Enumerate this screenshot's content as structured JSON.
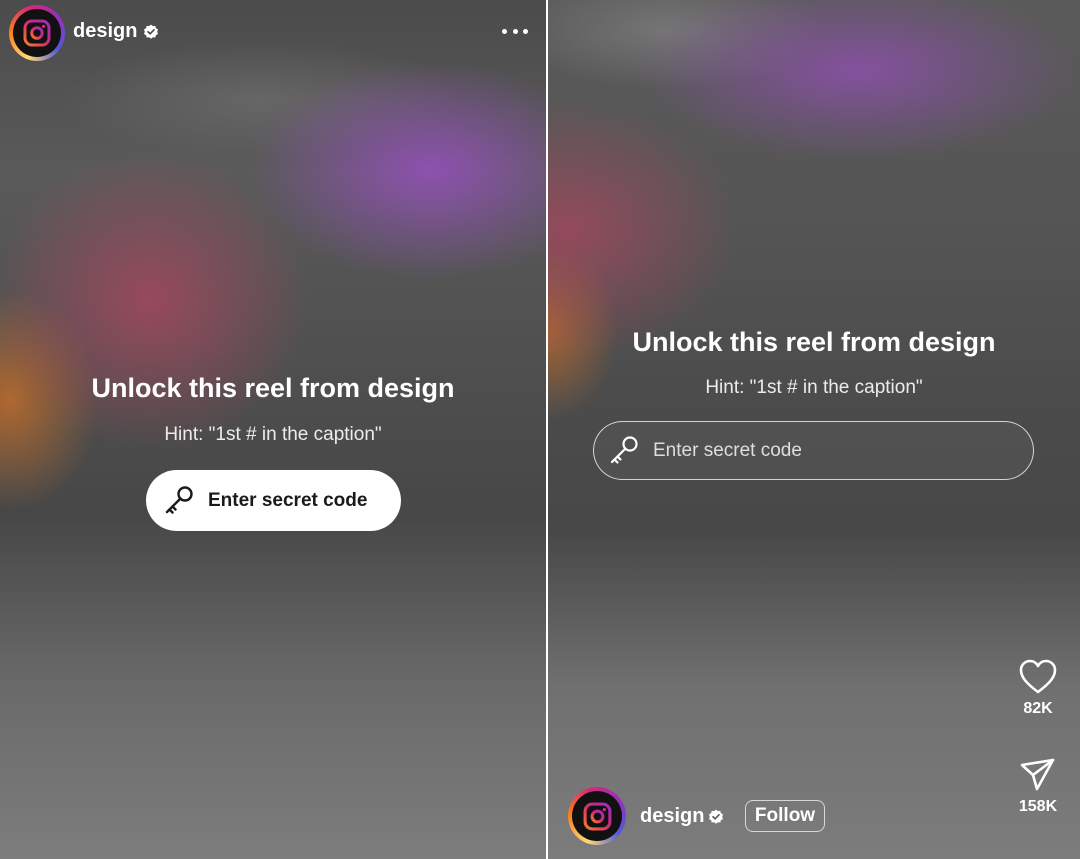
{
  "left_screen": {
    "header": {
      "username": "design",
      "avatar_icon": "instagram-logo-icon",
      "verified_icon": "verified-badge-icon",
      "more_icon": "more-options-icon"
    },
    "title": "Unlock this reel from design",
    "hint": "Hint: \"1st # in the caption\"",
    "code_button": {
      "icon": "key-icon",
      "label": "Enter secret code"
    }
  },
  "right_screen": {
    "title": "Unlock this reel from design",
    "hint": "Hint: \"1st # in the caption\"",
    "code_input": {
      "icon": "key-icon",
      "placeholder": "Enter secret code",
      "value": ""
    },
    "actions": {
      "like": {
        "icon": "heart-icon",
        "count": "82K"
      },
      "share": {
        "icon": "send-icon",
        "count": "158K"
      }
    },
    "footer": {
      "username": "design",
      "avatar_icon": "instagram-logo-icon",
      "verified_icon": "verified-badge-icon",
      "follow_label": "Follow"
    }
  },
  "colors": {
    "text": "#ffffff",
    "button_bg": "#ffffff",
    "button_text": "#1a1a1a",
    "ring_gradient": [
      "#feda75",
      "#fa7e1e",
      "#d62976",
      "#962fbf",
      "#4f5bd5"
    ]
  }
}
